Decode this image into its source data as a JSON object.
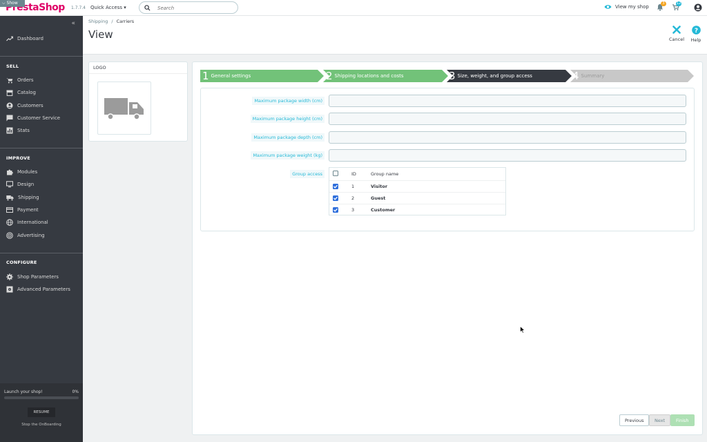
{
  "header": {
    "logo_show": "Show",
    "logo_text": "PrestaShop",
    "version": "1.7.7.4",
    "quick_access": "Quick Access ▾",
    "search_placeholder": "Search",
    "view_shop": "View my shop",
    "notifications_badge": "3",
    "orders_badge": "12"
  },
  "sidebar": {
    "dashboard": "Dashboard",
    "sections": {
      "sell": "SELL",
      "improve": "IMPROVE",
      "configure": "CONFIGURE"
    },
    "sell_items": [
      "Orders",
      "Catalog",
      "Customers",
      "Customer Service",
      "Stats"
    ],
    "improve_items": [
      "Modules",
      "Design",
      "Shipping",
      "Payment",
      "International",
      "Advertising"
    ],
    "configure_items": [
      "Shop Parameters",
      "Advanced Parameters"
    ],
    "onboarding": {
      "launch": "Launch your shop!",
      "percent": "0%",
      "progress": 0,
      "resume": "RESUME",
      "stop": "Stop the OnBoarding"
    }
  },
  "page": {
    "breadcrumb": [
      "Shipping",
      "Carriers"
    ],
    "title": "View",
    "cancel": "Cancel",
    "help": "Help"
  },
  "logo_panel": {
    "heading": "LOGO"
  },
  "steps": [
    {
      "num": "1",
      "label": "General settings",
      "state": "done",
      "color": "#72c279"
    },
    {
      "num": "2",
      "label": "Shipping locations and costs",
      "state": "done",
      "color": "#72c279"
    },
    {
      "num": "3",
      "label": "Size, weight, and group access",
      "state": "current",
      "color": "#363a41"
    },
    {
      "num": "4",
      "label": "Summary",
      "state": "todo",
      "color": "#c8c8c8"
    }
  ],
  "form": {
    "width_label": "Maximum package width (cm)",
    "height_label": "Maximum package height (cm)",
    "depth_label": "Maximum package depth (cm)",
    "weight_label": "Maximum package weight (kg)",
    "width_value": "",
    "height_value": "",
    "depth_value": "",
    "weight_value": "",
    "group_label": "Group access",
    "group_table": {
      "col_id": "ID",
      "col_name": "Group name",
      "rows": [
        {
          "id": "1",
          "name": "Visitor",
          "checked": true
        },
        {
          "id": "2",
          "name": "Guest",
          "checked": true
        },
        {
          "id": "3",
          "name": "Customer",
          "checked": true
        }
      ]
    }
  },
  "buttons": {
    "previous": "Previous",
    "next": "Next",
    "finish": "Finish"
  },
  "colors": {
    "brand": "#df0067",
    "accent": "#25b9d7",
    "success": "#72c279",
    "sidebar": "#363a41"
  }
}
